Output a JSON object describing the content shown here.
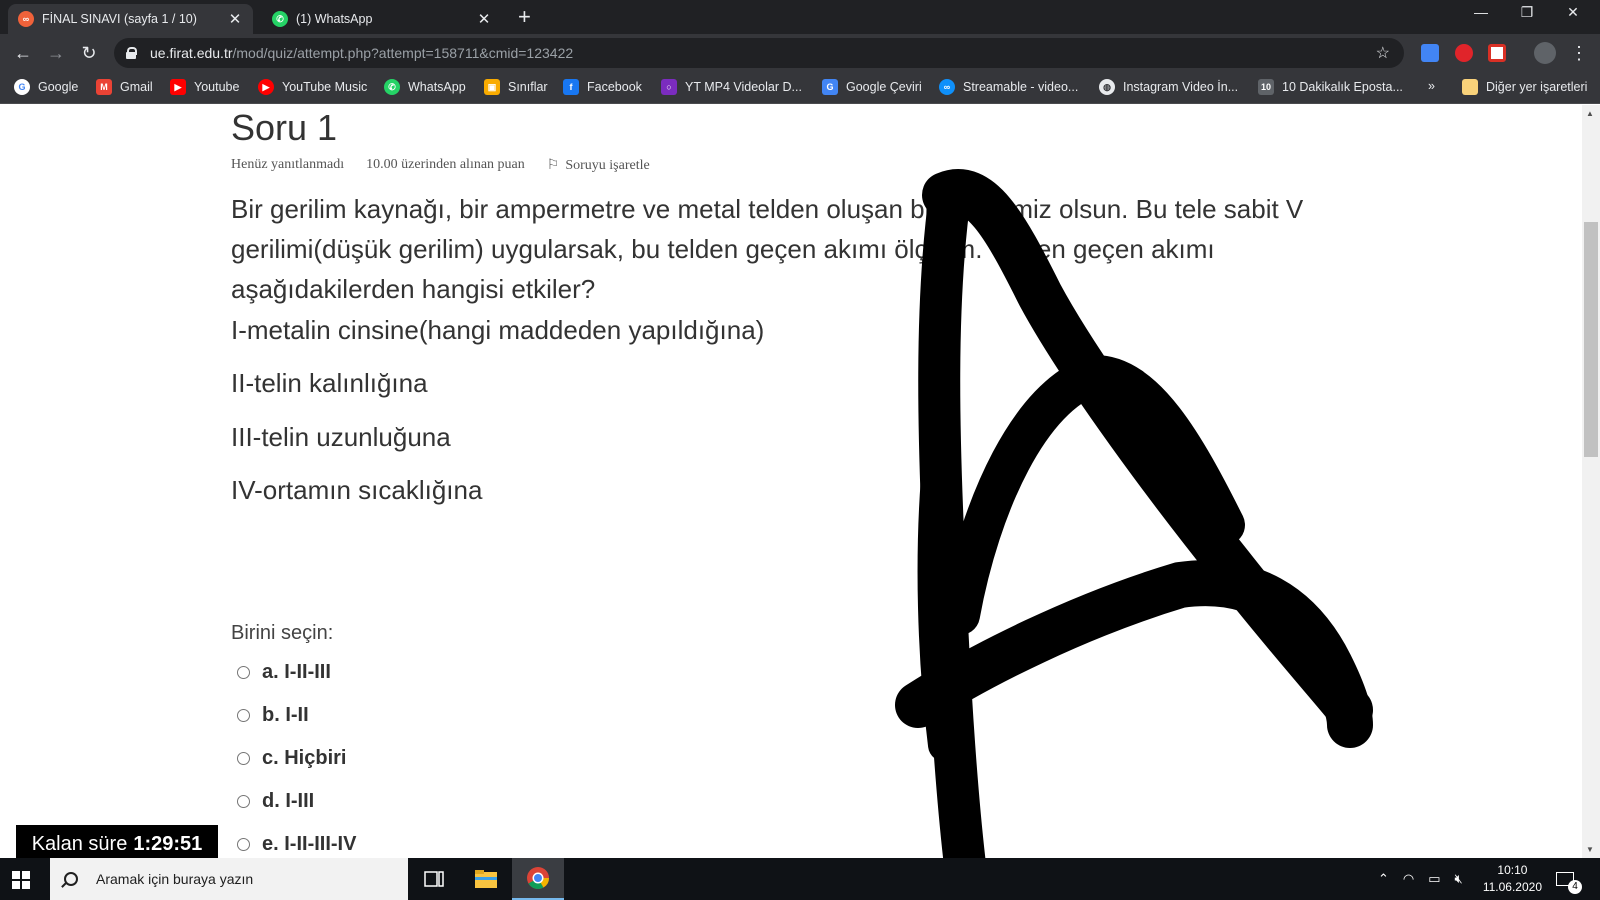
{
  "browser": {
    "tabs": [
      {
        "title": "FİNAL SINAVI (sayfa 1 / 10)",
        "close": "✕",
        "active": true
      },
      {
        "title": "(1) WhatsApp",
        "close": "✕",
        "active": false
      }
    ],
    "new_tab": "+",
    "window_controls": {
      "minimize": "—",
      "restore": "❐",
      "close": "✕"
    },
    "url_host": "ue.firat.edu.tr",
    "url_path": "/mod/quiz/attempt.php?attempt=158711&cmid=123422",
    "bookmarks": [
      {
        "label": "Google",
        "icon": "google-icon",
        "color": "#ffffff"
      },
      {
        "label": "Gmail",
        "icon": "gmail-icon",
        "color": "#ea4335"
      },
      {
        "label": "Youtube",
        "icon": "youtube-icon",
        "color": "#ff0000"
      },
      {
        "label": "YouTube Music",
        "icon": "youtube-music-icon",
        "color": "#ff0000"
      },
      {
        "label": "WhatsApp",
        "icon": "whatsapp-icon",
        "color": "#25d366"
      },
      {
        "label": "Sınıflar",
        "icon": "classroom-icon",
        "color": "#f9ab00"
      },
      {
        "label": "Facebook",
        "icon": "facebook-icon",
        "color": "#1877f2"
      },
      {
        "label": "YT MP4 Videolar D...",
        "icon": "video-download-icon",
        "color": "#7b2cbf"
      },
      {
        "label": "Google Çeviri",
        "icon": "translate-icon",
        "color": "#4285f4"
      },
      {
        "label": "Streamable - video...",
        "icon": "streamable-icon",
        "color": "#0f90fa"
      },
      {
        "label": "Instagram Video İn...",
        "icon": "globe-icon",
        "color": "#e8eaed"
      },
      {
        "label": "10 Dakikalık Eposta...",
        "icon": "ten-minute-mail-icon",
        "color": "#5f6368"
      }
    ],
    "more_bookmarks": "»",
    "other_bookmarks": "Diğer yer işaretleri"
  },
  "quiz": {
    "title": "Soru 1",
    "status": "Henüz yanıtlanmadı",
    "points": "10.00 üzerinden alınan puan",
    "flag_label": "Soruyu işaretle",
    "question": "Bir gerilim kaynağı, bir ampermetre ve metal telden oluşan bir devremiz olsun. Bu tele sabit V gerilimi(düşük gerilim) uygularsak, bu telden geçen akımı ölçelim. Telden geçen akımı aşağıdakilerden hangisi etkiler?",
    "items": [
      "I-metalin cinsine(hangi maddeden yapıldığına)",
      "II-telin kalınlığına",
      "III-telin uzunluğuna",
      "IV-ortamın sıcaklığına"
    ],
    "choose_label": "Birini seçin:",
    "options": [
      "a. I-II-III",
      "b. I-II",
      "c. Hiçbiri",
      "d. I-III",
      "e. I-II-III-IV"
    ],
    "timer_label": "Kalan süre",
    "timer_value": "1:29:51"
  },
  "taskbar": {
    "search_placeholder": "Aramak için buraya yazın",
    "time": "10:10",
    "date": "11.06.2020",
    "notification_count": "4"
  }
}
